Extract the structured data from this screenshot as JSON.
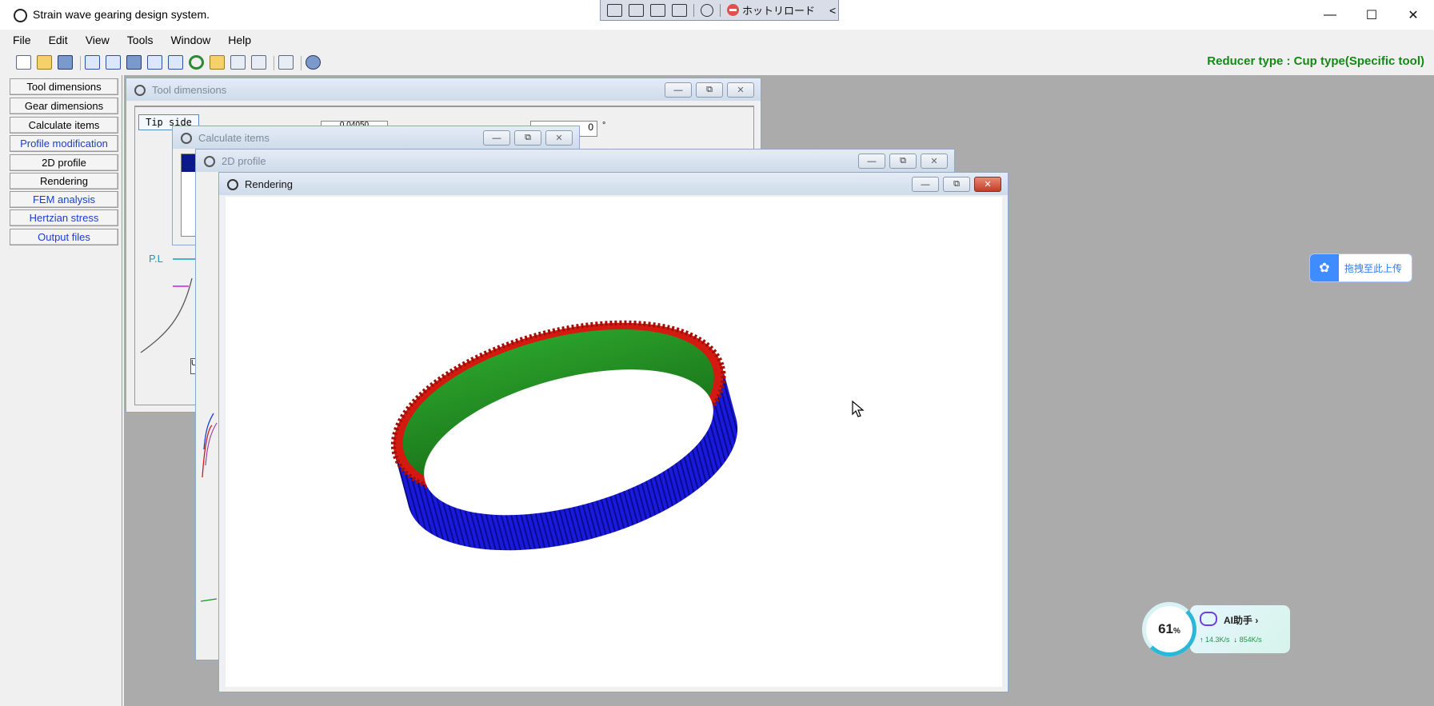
{
  "window": {
    "title": "Strain wave gearing design system.",
    "minimize": "—",
    "maximize": "☐",
    "close": "✕"
  },
  "remote_bar": {
    "hot_reload": "ホットリロード",
    "collapse": "<"
  },
  "menu": [
    "File",
    "Edit",
    "View",
    "Tools",
    "Window",
    "Help"
  ],
  "reducer_type": "Reducer type : Cup type(Specific tool)",
  "nav": [
    {
      "label": "Tool dimensions"
    },
    {
      "label": "Gear dimensions"
    },
    {
      "label": "Calculate items"
    },
    {
      "label": "Profile modification"
    },
    {
      "label": "2D profile"
    },
    {
      "label": "Rendering"
    },
    {
      "label": "FEM analysis"
    },
    {
      "label": "Hertzian stress"
    },
    {
      "label": "Output files"
    }
  ],
  "windows": {
    "tool_dimensions": {
      "title": "Tool dimensions",
      "tab": "Tip side",
      "field1": "0.04050",
      "field2": "0",
      "unit": "°"
    },
    "calculate_items": {
      "title": "Calculate items"
    },
    "profile_2d": {
      "title": "2D profile",
      "pl": "P.L"
    },
    "rendering": {
      "title": "Rendering"
    }
  },
  "caption_buttons": {
    "min": "—",
    "max": "⧉",
    "close": "✕"
  },
  "upload": {
    "label": "拖拽至此上传"
  },
  "assistant": {
    "percent": "61",
    "percent_sign": "%",
    "name": "AI助手",
    "up": "14.3K/s",
    "down": "854K/s"
  },
  "colors": {
    "gear_outer": "#1a1adc",
    "gear_teeth": "#d41a10",
    "gear_inner": "#1e8a1e",
    "reducer_text": "#138a13"
  }
}
